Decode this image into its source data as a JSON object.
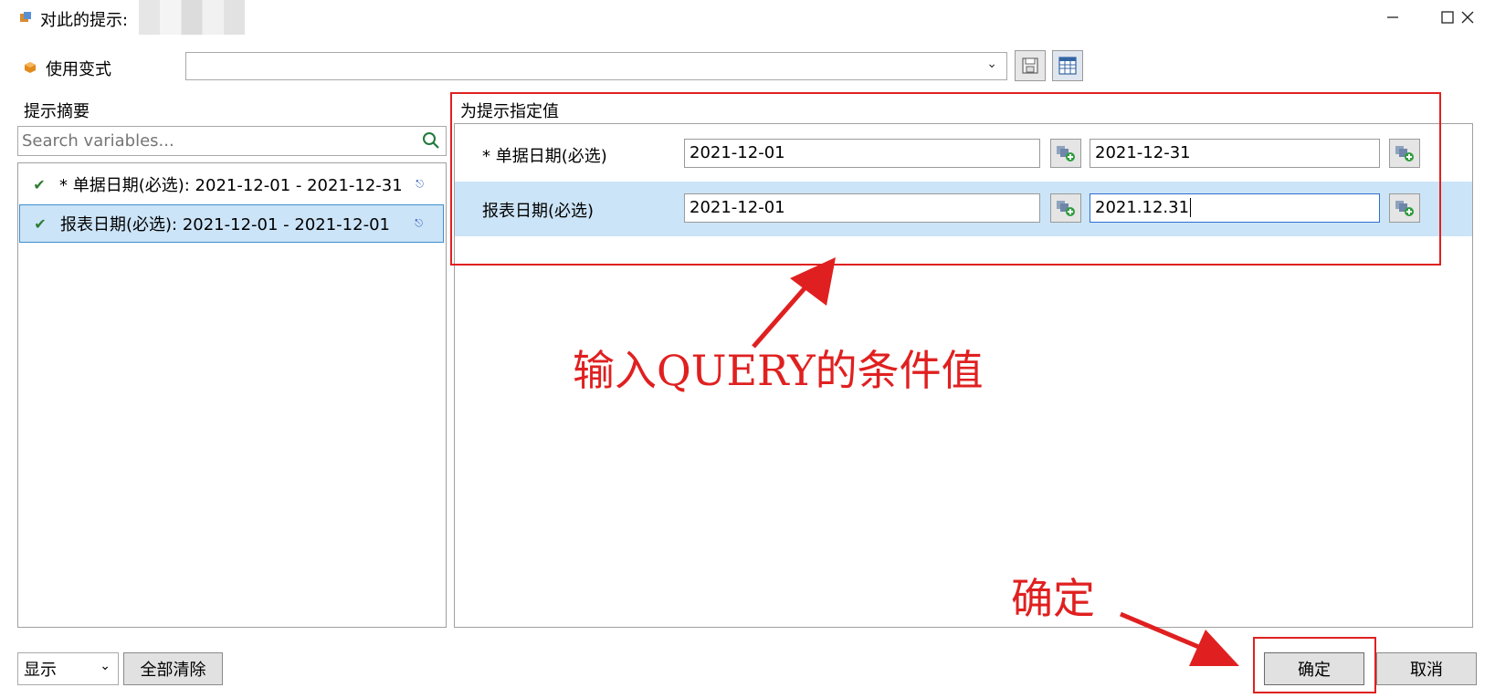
{
  "window": {
    "title": "对此的提示:",
    "app_icon": "app-icon",
    "controls": [
      "minimize-icon",
      "maximize-icon",
      "close-icon"
    ]
  },
  "variant": {
    "label": "使用变式",
    "value": "",
    "save_icon": "save-icon",
    "table_icon": "table-icon"
  },
  "summary": {
    "heading": "提示摘要",
    "search_placeholder": "Search variables...",
    "items": [
      {
        "text": "* 单据日期(必选): 2021-12-01 - 2021-12-31",
        "selected": false
      },
      {
        "text": "报表日期(必选): 2021-12-01 - 2021-12-01",
        "selected": true
      }
    ]
  },
  "values": {
    "heading": "为提示指定值",
    "rows": [
      {
        "label": "* 单据日期(必选)",
        "from": "2021-12-01",
        "to": "2021-12-31"
      },
      {
        "label": "报表日期(必选)",
        "from": "2021-12-01",
        "to": "2021.12.31"
      }
    ]
  },
  "annotations": {
    "query_note": "输入QUERY的条件值",
    "confirm_note": "确定",
    "color": "#e02020"
  },
  "footer": {
    "display_select": "显示",
    "clear_all": "全部清除",
    "ok": "确定",
    "cancel": "取消"
  }
}
